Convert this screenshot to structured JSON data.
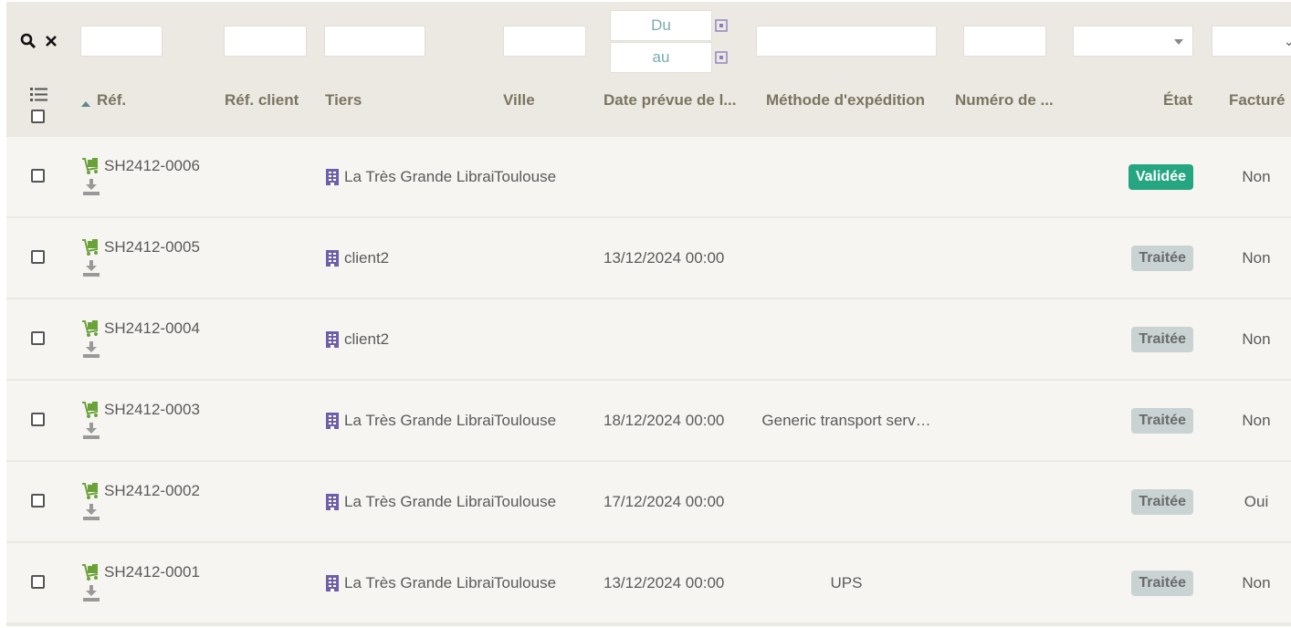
{
  "filters": {
    "date_from_placeholder": "Du",
    "date_to_placeholder": "au"
  },
  "columns": {
    "ref": "Réf.",
    "ref_client": "Réf. client",
    "tiers": "Tiers",
    "ville": "Ville",
    "date_prevue": "Date prévue de l...",
    "methode": "Méthode d'expédition",
    "numero": "Numéro de ...",
    "etat": "État",
    "facture": "Facturé"
  },
  "rows": [
    {
      "ref": "SH2412-0006",
      "tiers": "La Très Grande Librai",
      "ville": "Toulouse",
      "date": "",
      "methode": "",
      "etat": "Validée",
      "etat_type": "validee",
      "facture": "Non"
    },
    {
      "ref": "SH2412-0005",
      "tiers": "client2",
      "ville": "",
      "date": "13/12/2024 00:00",
      "methode": "",
      "etat": "Traitée",
      "etat_type": "traitee",
      "facture": "Non"
    },
    {
      "ref": "SH2412-0004",
      "tiers": "client2",
      "ville": "",
      "date": "",
      "methode": "",
      "etat": "Traitée",
      "etat_type": "traitee",
      "facture": "Non"
    },
    {
      "ref": "SH2412-0003",
      "tiers": "La Très Grande Librai",
      "ville": "Toulouse",
      "date": "18/12/2024 00:00",
      "methode": "Generic transport serv…",
      "etat": "Traitée",
      "etat_type": "traitee",
      "facture": "Non"
    },
    {
      "ref": "SH2412-0002",
      "tiers": "La Très Grande Librai",
      "ville": "Toulouse",
      "date": "17/12/2024 00:00",
      "methode": "",
      "etat": "Traitée",
      "etat_type": "traitee",
      "facture": "Oui"
    },
    {
      "ref": "SH2412-0001",
      "tiers": "La Très Grande Librai",
      "ville": "Toulouse",
      "date": "13/12/2024 00:00",
      "methode": "UPS",
      "etat": "Traitée",
      "etat_type": "traitee",
      "facture": "Non"
    }
  ]
}
